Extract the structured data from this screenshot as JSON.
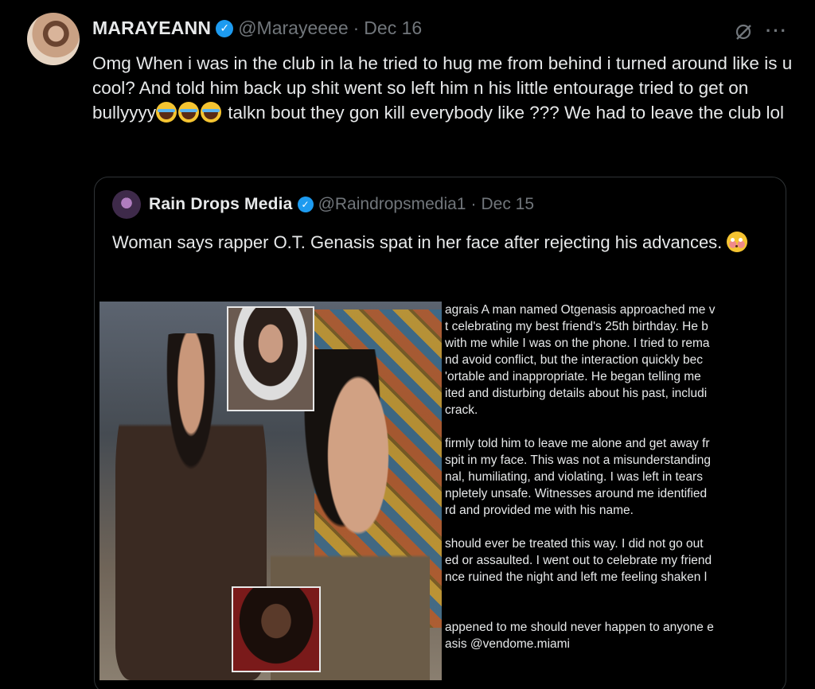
{
  "tweet": {
    "display_name": "MARAYEANN",
    "handle": "@Marayeeee",
    "separator": "·",
    "date": "Dec 16",
    "more": "···",
    "text_part1": "Omg When i was in the club in la he tried to hug me from behind i turned around like is u cool? And told him back up shit went so left him n his little entourage tried to get on bullyyyy",
    "text_part2": " talkn bout they gon kill everybody like ??? We had to leave the club lol"
  },
  "quote": {
    "display_name": "Rain Drops Media",
    "handle": "@Raindropsmedia1",
    "separator": "·",
    "date": "Dec 15",
    "text": "Woman says rapper O.T. Genasis spat in her face after rejecting his advances. ",
    "statement_lines": [
      "agrais A man named Otgenasis approached me v",
      "t celebrating my best friend's 25th birthday. He b",
      "with me while I was on the phone. I tried to rema",
      "nd avoid conflict, but the interaction quickly bec",
      "'ortable and inappropriate. He began telling me",
      "ited and disturbing details about his past, includi",
      "crack.",
      "",
      "firmly told him to leave me alone and get away fr",
      "spit in my face. This was not a misunderstanding",
      "nal, humiliating, and violating. I was left in tears",
      "npletely unsafe. Witnesses around me identified",
      "rd and provided me with his name.",
      "",
      "should ever be treated this way. I did not go out",
      "ed or assaulted. I went out to celebrate my friend",
      "nce ruined the night and left me feeling shaken l",
      "",
      "",
      "appened to me should never happen to anyone e",
      "asis @vendome.miami"
    ]
  },
  "icons": {
    "verified": "verified-badge-icon",
    "grok": "grok-icon",
    "more": "more-icon",
    "emoji_cry": "loudly-crying-face-emoji",
    "emoji_flushed": "flushed-face-emoji"
  },
  "colors": {
    "background": "#000000",
    "text": "#e7e9ea",
    "secondary": "#71767b",
    "verified": "#1d9bf0",
    "border": "#2f3336"
  }
}
